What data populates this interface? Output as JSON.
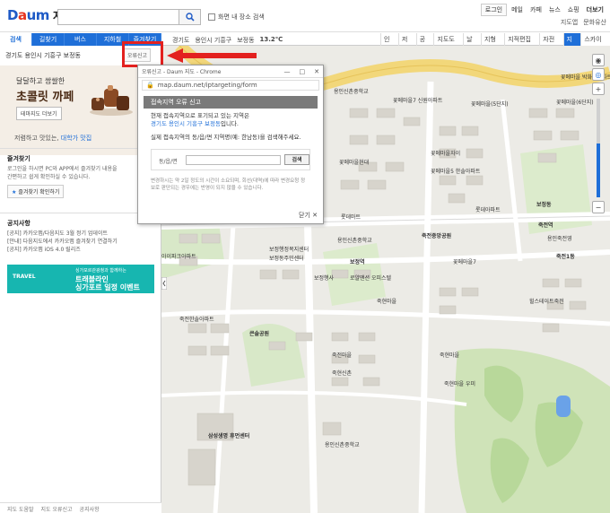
{
  "header": {
    "logo_d": "D",
    "logo_a": "a",
    "logo_um": "um",
    "logo_title": "지도",
    "checkbox_label": "화면 내 장소 검색",
    "links": [
      "로그인",
      "메일",
      "카페",
      "뉴스",
      "쇼핑",
      "더보기"
    ],
    "links2": [
      "지도앱",
      "문화유산"
    ]
  },
  "tabs": [
    "검색",
    "길찾기",
    "버스",
    "지하철",
    "즐겨찾기"
  ],
  "crumb": [
    "경기도",
    "용인시 기흥구",
    "보정동",
    "13.2℃"
  ],
  "maptools": [
    "인쇄",
    "저장",
    "공유",
    "지도도구",
    "날씨",
    "지형도",
    "지적편집도",
    "자전거",
    "지도",
    "스카이뷰"
  ],
  "sidebar": {
    "location": "경기도 용인시 기흥구 보정동",
    "report": "오류신고",
    "banner_line1": "달달하고 쌉쌀한",
    "banner_line2": "초콜릿 까페",
    "banner_btn": "테마지도 더보기",
    "taste_text": "저렴하고 맛있는,",
    "taste_hl": "대학가 맛집",
    "fav_title": "즐겨찾기",
    "fav_desc1": "로그인을 하시면 PC와 APP에서 즐겨찾기 내용을",
    "fav_desc2": "간편하고 쉽게 확인하실 수 있습니다.",
    "fav_btn": "즐겨찾기 확인하기",
    "notice_title": "공지사항",
    "notices": [
      "[공지] 카카오맵/다음지도 3월 정기 업데이트",
      "[안내] 다음지도에서 카카오맵 즐겨찾기 연결하기",
      "[공지] 카카오맵 iOS 4.0 릴리즈"
    ],
    "travel_logo": "TRAVEL",
    "travel_r1": "싱가포르관광청과 함께하는",
    "travel_r2": "트래블라인",
    "travel_r3": "싱가포르 일정 이벤트",
    "footer": [
      "지도 도움말",
      "지도 오류신고",
      "공지사항"
    ]
  },
  "popup": {
    "title": "오류신고 - Daum 지도 - Chrome",
    "url": "map.daum.net/iptargeting/form",
    "head": "접속지역 오류 신고",
    "line1": "현재 접속지역으로 표기되고 있는 지역은",
    "line2_blue": "경기도 용인시 기흥구 보정동",
    "line2_rest": "입니다.",
    "line3": "실제 접속지역의 동/읍/면 지역명(예: 한남동)을 검색해주세요.",
    "form_label": "동/읍/면",
    "search_btn": "검색",
    "note1": "변경하시는 약 2일 정도의 시간이 소요되며, 회선(대역)에 따라 변경요청 정",
    "note2": "보로 판단되는 경우에는 반영이 되지 않을 수 있습니다.",
    "close": "닫기"
  },
  "map_labels": [
    "용인신촌중학교",
    "꽃메마을7 신원아파트",
    "꽃메마을 박화영아파트",
    "꽃메마을(6단지)",
    "꽃메마을(5단지)",
    "보정동",
    "꽃메마을자이",
    "꽃메마을현대",
    "꽃메마을5 한솔아파트",
    "롯데마트",
    "롯데아파트",
    "용인신촌중학교",
    "죽전중앙공원",
    "보정역",
    "꽃메마을7",
    "죽전역",
    "용인죽전영",
    "아이파크아파트",
    "보정행정복지센터",
    "보정동주민센터",
    "죽전한솔아파트",
    "큰솔공원",
    "보정행사",
    "로얄맨션 오피스텔",
    "죽현마을",
    "힐스테이트죽전",
    "죽전1동",
    "죽현마을 우미",
    "죽전마을",
    "삼성생명 휴먼센터",
    "용인신촌중학교",
    "죽현마을",
    "죽현신촌"
  ]
}
